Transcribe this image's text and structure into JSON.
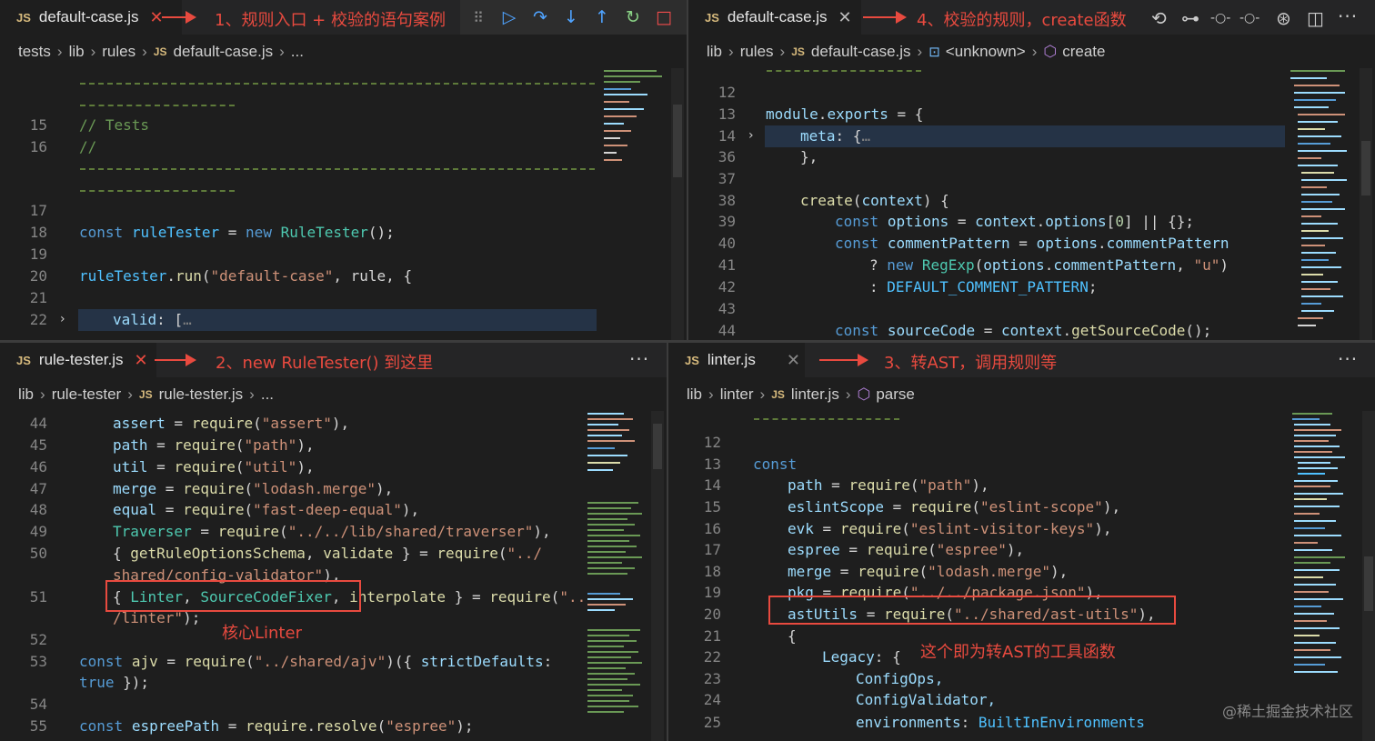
{
  "panes": {
    "top_left": {
      "tab": {
        "file_icon": "JS",
        "label": "default-case.js",
        "close": "✕"
      },
      "annotation": "1、规则入口 + 校验的语句案例",
      "debug_toolbar": {
        "grip": "⠿",
        "continue": "▷",
        "step_over": "↷",
        "step_into": "↓",
        "step_out": "↑",
        "restart": "↻",
        "stop": "□"
      },
      "breadcrumb": [
        "tests",
        "lib",
        "rules",
        "default-case.js",
        "..."
      ],
      "lines": {
        "l15": "15",
        "l16": "16",
        "l17": "17",
        "l18": "18",
        "l19": "19",
        "l20": "20",
        "l21": "21",
        "l22": "22"
      },
      "code": {
        "l15": "// Tests",
        "l16": "//",
        "l18a": "const",
        "l18b": "ruleTester",
        "l18c": " = ",
        "l18d": "new",
        "l18e": "RuleTester",
        "l18f": "();",
        "l20a": "ruleTester",
        "l20b": ".",
        "l20c": "run",
        "l20d": "(",
        "l20e": "\"default-case\"",
        "l20f": ", rule, {",
        "l22a": "valid",
        "l22b": ": [",
        "l22c": "…"
      }
    },
    "top_right": {
      "tab": {
        "file_icon": "JS",
        "label": "default-case.js",
        "close": "✕"
      },
      "annotation": "4、校验的规则，create函数",
      "toolbar_icons": [
        "history-icon",
        "git-commit-icon",
        "previous-change-icon",
        "next-change-icon",
        "debug-alt-icon",
        "split-editor-icon"
      ],
      "toolbar_glyphs": [
        "⟲",
        "⊶",
        "-○-",
        "-○-",
        "⊛",
        "◫"
      ],
      "more": "···",
      "breadcrumb": [
        "lib",
        "rules",
        "default-case.js",
        "<unknown>",
        "create"
      ],
      "lines": {
        "l12": "12",
        "l13": "13",
        "l14": "14",
        "l36": "36",
        "l37": "37",
        "l38": "38",
        "l39": "39",
        "l40": "40",
        "l41": "41",
        "l42": "42",
        "l43": "43",
        "l44": "44"
      },
      "code": {
        "l13a": "module",
        "l13b": ".",
        "l13c": "exports",
        "l13d": " = {",
        "l14a": "meta",
        "l14b": ": {",
        "l14c": "…",
        "l36": "},",
        "l38a": "create",
        "l38b": "(",
        "l38c": "context",
        "l38d": ") {",
        "l39a": "const",
        "l39b": "options",
        "l39c": " = ",
        "l39d": "context",
        "l39e": ".",
        "l39f": "options",
        "l39g": "[",
        "l39h": "0",
        "l39i": "] || {};",
        "l40a": "const",
        "l40b": "commentPattern",
        "l40c": " = ",
        "l40d": "options",
        "l40e": ".",
        "l40f": "commentPattern",
        "l41a": "? ",
        "l41b": "new",
        "l41c": "RegExp",
        "l41d": "(",
        "l41e": "options",
        "l41f": ".",
        "l41g": "commentPattern",
        "l41h": ", ",
        "l41i": "\"u\"",
        "l41j": ")",
        "l42a": ": ",
        "l42b": "DEFAULT_COMMENT_PATTERN",
        "l42c": ";",
        "l44a": "const",
        "l44b": "sourceCode",
        "l44c": " = ",
        "l44d": "context",
        "l44e": ".",
        "l44f": "getSourceCode",
        "l44g": "();"
      }
    },
    "bottom_left": {
      "tab": {
        "file_icon": "JS",
        "label": "rule-tester.js",
        "close": "✕"
      },
      "annotation": "2、new RuleTester() 到这里",
      "more": "···",
      "breadcrumb": [
        "lib",
        "rule-tester",
        "rule-tester.js",
        "..."
      ],
      "box_label": "核心Linter",
      "lines": {
        "l44": "44",
        "l45": "45",
        "l46": "46",
        "l47": "47",
        "l48": "48",
        "l49": "49",
        "l50": "50",
        "l51": "51",
        "l52": "52",
        "l53": "53",
        "l54": "54",
        "l55": "55"
      },
      "code": {
        "l44a": "assert",
        "l44b": " = ",
        "l44c": "require",
        "l44d": "(",
        "l44e": "\"assert\"",
        "l44f": "),",
        "l45a": "path",
        "l45b": " = ",
        "l45c": "require",
        "l45d": "(",
        "l45e": "\"path\"",
        "l45f": "),",
        "l46a": "util",
        "l46b": " = ",
        "l46c": "require",
        "l46d": "(",
        "l46e": "\"util\"",
        "l46f": "),",
        "l47a": "merge",
        "l47b": " = ",
        "l47c": "require",
        "l47d": "(",
        "l47e": "\"lodash.merge\"",
        "l47f": "),",
        "l48a": "equal",
        "l48b": " = ",
        "l48c": "require",
        "l48d": "(",
        "l48e": "\"fast-deep-equal\"",
        "l48f": "),",
        "l49a": "Traverser",
        "l49b": " = ",
        "l49c": "require",
        "l49d": "(",
        "l49e": "\"../../lib/shared/traverser\"",
        "l49f": "),",
        "l50a": "{ ",
        "l50b": "getRuleOptionsSchema",
        "l50c": ", ",
        "l50d": "validate",
        "l50e": " } = ",
        "l50f": "require",
        "l50g": "(",
        "l50h": "\"../",
        "l50w": "shared/config-validator\"",
        "l50x": "),",
        "l51a": "{ ",
        "l51b": "Linter",
        "l51c": ", ",
        "l51d": "SourceCodeFixer",
        "l51e": ", ",
        "l51f": "interpolate",
        "l51g": " } = ",
        "l51h": "require",
        "l51i": "(",
        "l51j": "\"..",
        "l51w": "/linter\"",
        "l51x": ");",
        "l53a": "const",
        "l53b": "ajv",
        "l53c": " = ",
        "l53d": "require",
        "l53e": "(",
        "l53f": "\"../shared/ajv\"",
        "l53g": ")({ ",
        "l53h": "strictDefaults",
        "l53i": ":",
        "l53w": "true",
        "l53x": " });",
        "l55a": "const",
        "l55b": "espreePath",
        "l55c": " = ",
        "l55d": "require",
        "l55e": ".",
        "l55f": "resolve",
        "l55g": "(",
        "l55h": "\"espree\"",
        "l55i": ");"
      }
    },
    "bottom_right": {
      "tab": {
        "file_icon": "JS",
        "label": "linter.js",
        "close": "✕"
      },
      "annotation": "3、转AST，调用规则等",
      "more": "···",
      "breadcrumb": [
        "lib",
        "linter",
        "linter.js",
        "parse"
      ],
      "box_label": "这个即为转AST的工具函数",
      "lines": {
        "l12": "12",
        "l13": "13",
        "l14": "14",
        "l15": "15",
        "l16": "16",
        "l17": "17",
        "l18": "18",
        "l19": "19",
        "l20": "20",
        "l21": "21",
        "l22": "22",
        "l23": "23",
        "l24": "24",
        "l25": "25"
      },
      "code": {
        "l13": "const",
        "l14a": "path",
        "l14b": " = ",
        "l14c": "require",
        "l14d": "(",
        "l14e": "\"path\"",
        "l14f": "),",
        "l15a": "eslintScope",
        "l15b": " = ",
        "l15c": "require",
        "l15d": "(",
        "l15e": "\"eslint-scope\"",
        "l15f": "),",
        "l16a": "evk",
        "l16b": " = ",
        "l16c": "require",
        "l16d": "(",
        "l16e": "\"eslint-visitor-keys\"",
        "l16f": "),",
        "l17a": "espree",
        "l17b": " = ",
        "l17c": "require",
        "l17d": "(",
        "l17e": "\"espree\"",
        "l17f": "),",
        "l18a": "merge",
        "l18b": " = ",
        "l18c": "require",
        "l18d": "(",
        "l18e": "\"lodash.merge\"",
        "l18f": "),",
        "l19a": "pkg",
        "l19b": " = ",
        "l19c": "require",
        "l19d": "(",
        "l19e": "\"../../package.json\"",
        "l19f": "),",
        "l20a": "astUtils",
        "l20b": " = ",
        "l20c": "require",
        "l20d": "(",
        "l20e": "\"../shared/ast-utils\"",
        "l20f": "),",
        "l21": "{",
        "l22a": "Legacy",
        "l22b": ": {",
        "l23": "ConfigOps,",
        "l24": "ConfigValidator,",
        "l25a": "environments",
        "l25b": ": ",
        "l25c": "BuiltInEnvironments"
      }
    }
  },
  "watermark": "@稀土掘金技术社区",
  "colors": {
    "annotation_red": "#e84a3f",
    "editor_bg": "#1e1e1e",
    "keyword": "#569cd6",
    "string": "#ce9178",
    "variable": "#9cdcfe",
    "function": "#dcdcaa",
    "comment": "#6a9955",
    "class": "#4ec9b0"
  }
}
